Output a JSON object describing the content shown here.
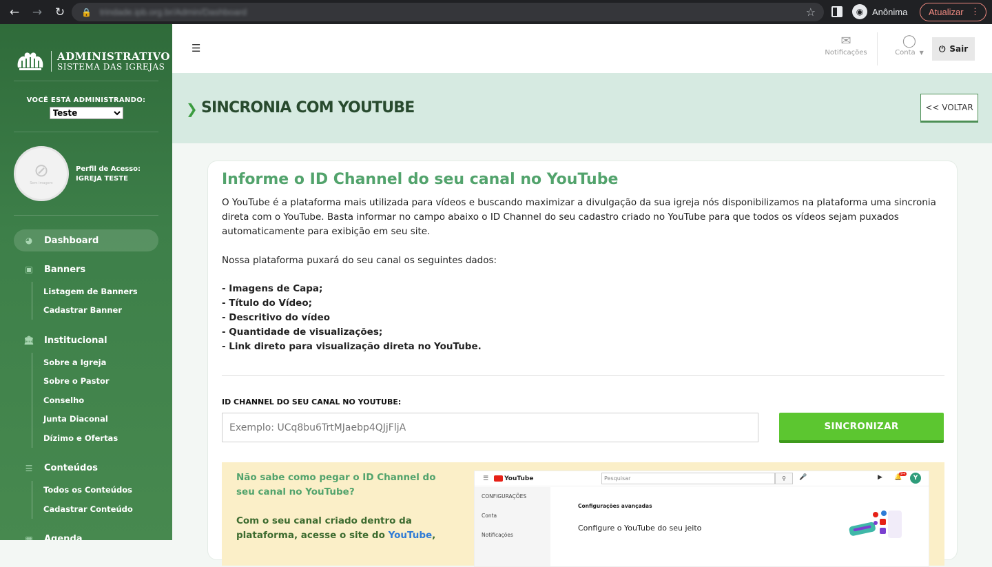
{
  "browser": {
    "url": "trindade.ipb.org.br/Admin/Dashboard",
    "profile_label": "Anônima",
    "update_label": "Atualizar"
  },
  "brand": {
    "title": "ADMINISTRATIVO",
    "subtitle": "SISTEMA DAS IGREJAS"
  },
  "sidebar": {
    "admin_label": "VOCÊ ESTÁ ADMINISTRANDO:",
    "admin_select": "Teste",
    "profile_photo_text": "Sem imagem",
    "profile_label": "Perfil de Acesso:",
    "profile_value": "IGREJA TESTE",
    "menu": [
      {
        "label": "Dashboard",
        "icon": "dashboard-icon",
        "active": true,
        "items": []
      },
      {
        "label": "Banners",
        "icon": "image-icon",
        "items": [
          "Listagem de Banners",
          "Cadastrar Banner"
        ]
      },
      {
        "label": "Institucional",
        "icon": "institution-icon",
        "items": [
          "Sobre a Igreja",
          "Sobre o Pastor",
          "Conselho",
          "Junta Diaconal",
          "Dízimo e Ofertas"
        ]
      },
      {
        "label": "Conteúdos",
        "icon": "list-icon",
        "items": [
          "Todos os Conteúdos",
          "Cadastrar Conteúdo"
        ]
      },
      {
        "label": "Agenda",
        "icon": "calendar-icon",
        "items": []
      }
    ]
  },
  "topbar": {
    "notifications_label": "Notificações",
    "account_label": "Conta",
    "logout_label": "Sair"
  },
  "page": {
    "title": "SINCRONIA COM YOUTUBE",
    "back_label": "<< VOLTAR"
  },
  "card": {
    "heading": "Informe o ID Channel do seu canal no YouTube",
    "description": "O YouTube é a plataforma mais utilizada para vídeos e buscando maximizar a divulgação da sua igreja nós disponibilizamos na plataforma uma sincronia direta com o YouTube. Basta informar no campo abaixo o ID Channel do seu cadastro criado no YouTube para que todos os vídeos sejam puxados automaticamente para exibição em seu site.",
    "data_intro": "Nossa plataforma puxará do seu canal os seguintes dados:",
    "bullets": [
      "- Imagens de Capa;",
      "- Título do Vídeo;",
      "- Descritivo do vídeo",
      "- Quantidade de visualizações;",
      "- Link direto para visualização direta no YouTube."
    ],
    "field_label": "ID CHANNEL DO SEU CANAL NO YOUTUBE:",
    "field_placeholder": "Exemplo: UCq8bu6TrtMJaebp4QJjFljA",
    "field_value": "",
    "sync_label": "SINCRONIZAR"
  },
  "help": {
    "question": "Não sabe como pegar o ID Channel do seu canal no YouTube?",
    "text_before_link": "Com o seu canal criado dentro da plataforma, acesse o site do ",
    "link": "YouTube",
    "text_after_link": ",",
    "yt_search_placeholder": "Pesquisar",
    "yt_side_heading": "CONFIGURAÇÕES",
    "yt_side_items": [
      "Conta",
      "Notificações"
    ],
    "yt_section": "Configurações avançadas",
    "yt_headline": "Configure o YouTube do seu jeito",
    "yt_logo": "YouTube",
    "yt_avatar": "Y",
    "yt_badge": "9+"
  },
  "colors": {
    "sidebar_green": "#3d7f49",
    "heading_green": "#52a36c",
    "sync_button": "#5cc630",
    "title_band": "#d6eae1",
    "help_bg": "#fbefc8"
  }
}
